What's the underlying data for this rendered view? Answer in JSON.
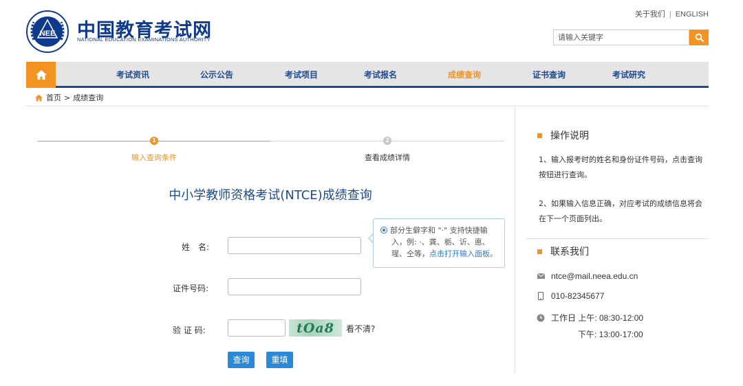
{
  "header": {
    "site_name_cn": "中国教育考试网",
    "site_name_en": "NATIONAL EDUCATION EXAMINATIONS AUTHORITY",
    "emblem_text": "NEE",
    "top_links": [
      "关于我们",
      "ENGLISH"
    ],
    "search_placeholder": "请输入关键字",
    "colors": {
      "brand_blue": "#1e4b8f",
      "accent_orange": "#f39321"
    }
  },
  "nav": {
    "items": [
      "考试资讯",
      "公示公告",
      "考试项目",
      "考试报名",
      "成绩查询",
      "证书查询",
      "考试研究"
    ],
    "active": "成绩查询"
  },
  "breadcrumb": {
    "home": "首页",
    "separator": ">",
    "current": "成绩查询"
  },
  "steps": [
    {
      "number": "1",
      "label": "输入查询条件"
    },
    {
      "number": "2",
      "label": "查看成绩详情"
    }
  ],
  "form": {
    "title": "中小学教师资格考试(NTCE)成绩查询",
    "name_label": "姓　名:",
    "id_label": "证件号码:",
    "captcha_label": "验 证 码:",
    "captcha_image_text": "tOa8",
    "refresh_label": "看不清?",
    "submit_label": "查询",
    "reset_label": "重填",
    "tip_lines": [
      "部分生僻字和 \"·\" 支持快捷输",
      "入，例: ·、龚、栃、䜣、悳、",
      "瑆、仝等，"
    ],
    "tip_link": "点击打开输入面板。"
  },
  "sidebar": {
    "instructions_title": "操作说明",
    "instructions": [
      "1、输入报考时的姓名和身份证件号码，点击查询按钮进行查询。",
      "2、如果输入信息正确，对应考试的成绩信息将会在下一个页面列出。"
    ],
    "contact_title": "联系我们",
    "email": "ntce@mail.neea.edu.cn",
    "phone": "010-82345677",
    "hours_morning": "工作日 上午: 08:30-12:00",
    "hours_afternoon": "下午: 13:00-17:00"
  }
}
